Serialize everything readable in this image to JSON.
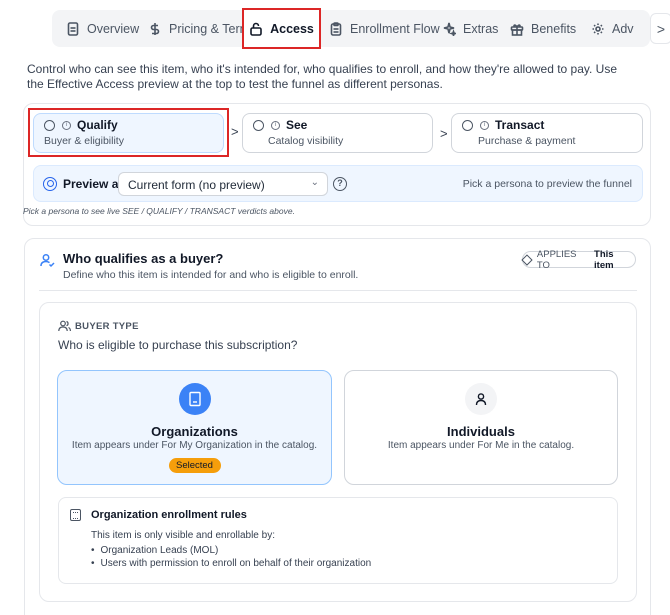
{
  "tabs": [
    {
      "label": "Overview",
      "icon": "document-icon"
    },
    {
      "label": "Pricing & Term",
      "icon": "dollar-icon"
    },
    {
      "label": "Access",
      "icon": "lock-icon",
      "active": true
    },
    {
      "label": "Enrollment Flow",
      "icon": "clipboard-icon"
    },
    {
      "label": "Extras",
      "icon": "sparkles-icon"
    },
    {
      "label": "Benefits",
      "icon": "gift-icon"
    },
    {
      "label": "Adv",
      "icon": "gear-icon"
    }
  ],
  "tab_next_glyph": ">",
  "intro": "Control who can see this item, who it's intended for, who qualifies to enroll, and how they're allowed to pay. Use the Effective Access preview at the top to test the funnel as different personas.",
  "funnel": {
    "steps": [
      {
        "title": "Qualify",
        "subtitle": "Buyer & eligibility",
        "selected": true
      },
      {
        "title": "See",
        "subtitle": "Catalog visibility"
      },
      {
        "title": "Transact",
        "subtitle": "Purchase & payment"
      }
    ],
    "chevron": ">",
    "preview_label": "Preview as",
    "preview_value": "Current form (no preview)",
    "help_glyph": "?",
    "preview_hint": "Pick a persona to preview the funnel",
    "note": "Pick a persona to see live SEE / QUALIFY / TRANSACT verdicts above."
  },
  "buyer": {
    "title": "Who qualifies as a buyer?",
    "subtitle": "Define who this item is intended for and who is eligible to enroll.",
    "applies_prefix": "APPLIES TO",
    "applies_target": "This item",
    "type_label": "BUYER TYPE",
    "question": "Who is eligible to purchase this subscription?",
    "options": [
      {
        "title": "Organizations",
        "desc": "Item appears under For My Organization in the catalog.",
        "badge": "Selected",
        "selected": true
      },
      {
        "title": "Individuals",
        "desc": "Item appears under For Me in the catalog."
      }
    ],
    "rules": {
      "title": "Organization enrollment rules",
      "intro": "This item is only visible and enrollable by:",
      "items": [
        "Organization Leads (MOL)",
        "Users with permission to enroll on behalf of their organization"
      ]
    }
  },
  "colors": {
    "accent": "#3b82f6",
    "highlight": "#dc2626",
    "badge": "#f59e0b",
    "selected_bg": "#eff6ff"
  }
}
